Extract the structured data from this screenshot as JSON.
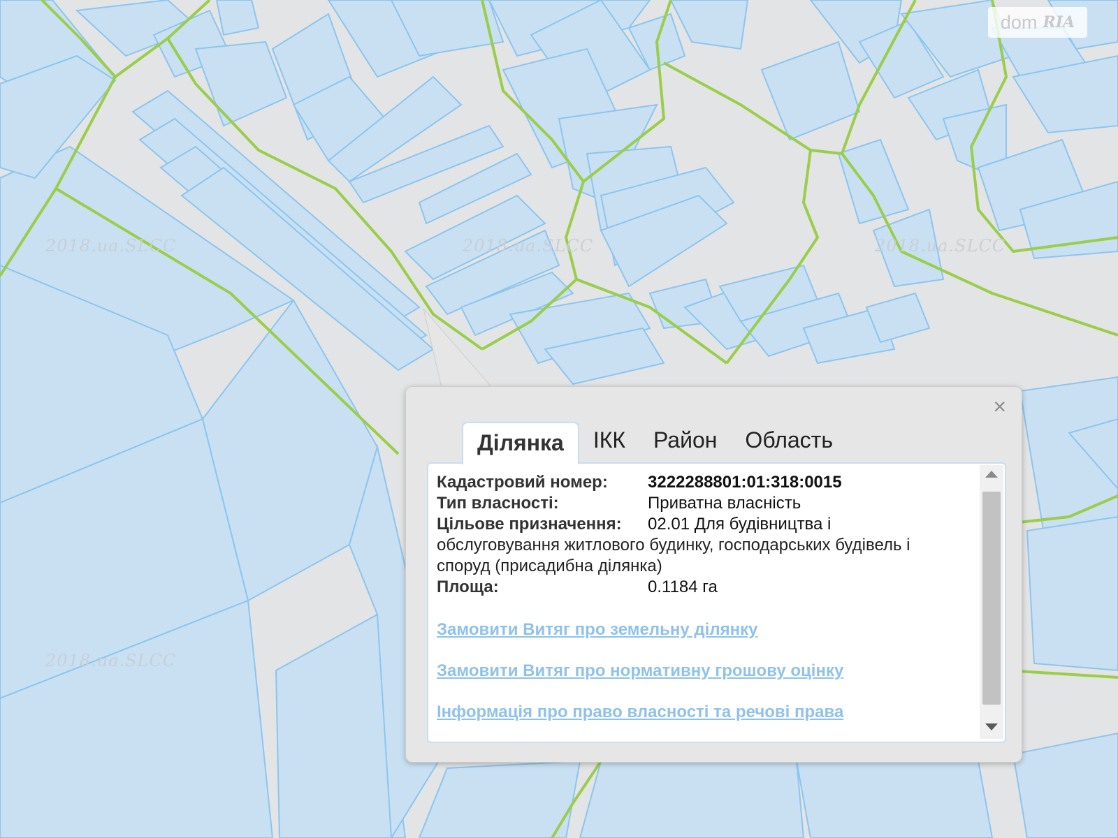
{
  "map": {
    "watermark": "2018.ua.SLCC",
    "colors": {
      "background": "#e3e4e5",
      "parcel_fill": "#c9e0f3",
      "parcel_stroke": "#8cc5ee",
      "boundary": "#9acd4a"
    }
  },
  "logo": {
    "text": "dom",
    "ria": "RIA"
  },
  "popup": {
    "close_icon": "×",
    "tabs": [
      {
        "label": "Ділянка",
        "active": true
      },
      {
        "label": "ІКК",
        "active": false
      },
      {
        "label": "Район",
        "active": false
      },
      {
        "label": "Область",
        "active": false
      }
    ],
    "fields": {
      "cadastral_label": "Кадастровий номер:",
      "cadastral_value": "3222288801:01:318:0015",
      "ownership_label": "Тип власності:",
      "ownership_value": "Приватна власність",
      "purpose_label": "Цільове призначення:",
      "purpose_value_1": "02.01 Для будівництва і",
      "purpose_value_2": "обслуговування житлового будинку, господарських будівель і",
      "purpose_value_3": "споруд (присадибна ділянка)",
      "area_label": "Площа:",
      "area_value": "0.1184 га"
    },
    "links": {
      "extract_land": "Замовити Витяг про земельну ділянку",
      "extract_valuation": "Замовити Витяг про нормативну грошову оцінку",
      "ownership_info": "Інформація про право власності та речові права"
    }
  }
}
